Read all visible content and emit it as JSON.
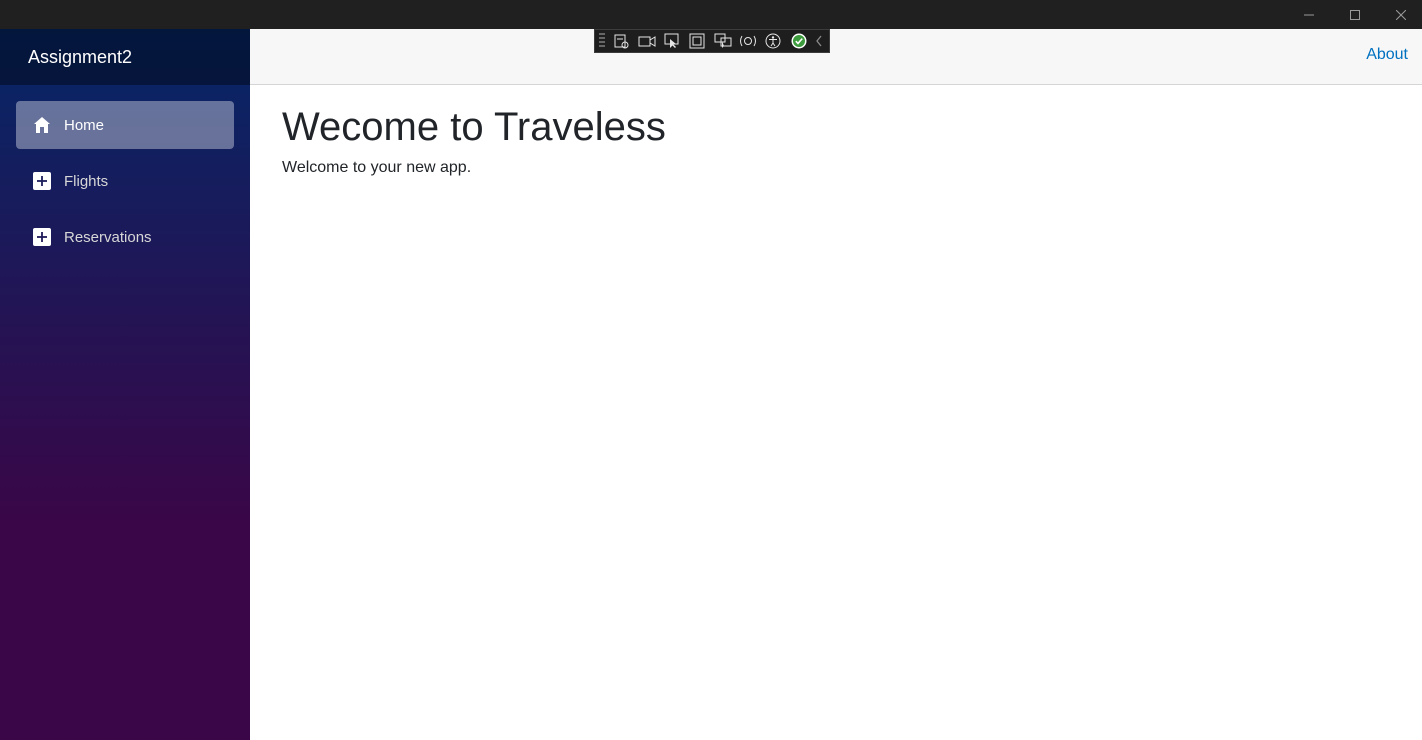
{
  "window": {
    "controls": [
      "minimize-icon",
      "maximize-icon",
      "close-icon"
    ]
  },
  "sidebar": {
    "brand": "Assignment2",
    "items": [
      {
        "label": "Home",
        "icon": "home-icon",
        "active": true
      },
      {
        "label": "Flights",
        "icon": "plus-icon",
        "active": false
      },
      {
        "label": "Reservations",
        "icon": "plus-icon",
        "active": false
      }
    ]
  },
  "header": {
    "about_label": "About"
  },
  "main": {
    "title": "Wecome to Traveless",
    "subtitle": "Welcome to your new app."
  },
  "colors": {
    "sidebar_top": "#052767",
    "sidebar_bottom": "#3a0647",
    "link": "#0071c1"
  }
}
